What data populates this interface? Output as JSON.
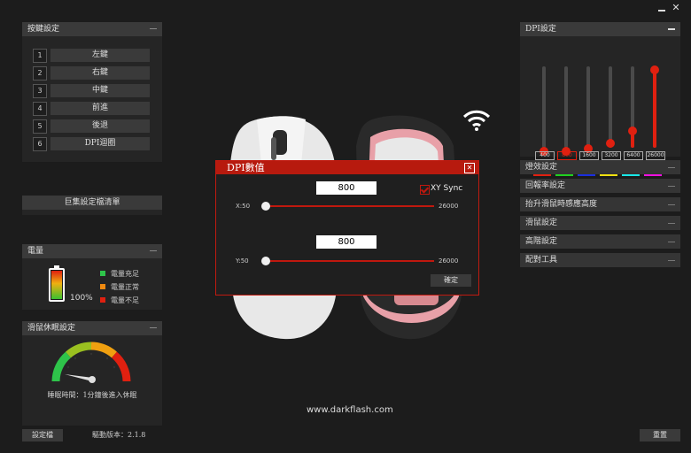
{
  "window": {
    "minimize_glyph": "—",
    "close_glyph": "✕"
  },
  "buttons_panel": {
    "title": "按鍵設定",
    "items": [
      {
        "num": "1",
        "label": "左鍵"
      },
      {
        "num": "2",
        "label": "右鍵"
      },
      {
        "num": "3",
        "label": "中鍵"
      },
      {
        "num": "4",
        "label": "前進"
      },
      {
        "num": "5",
        "label": "後退"
      },
      {
        "num": "6",
        "label": "DPI迴圈"
      }
    ]
  },
  "macro_list_label": "巨集設定檔清單",
  "battery": {
    "title": "電量",
    "percent_text": "100%",
    "level": 1.0,
    "legend": [
      {
        "label": "電量充足",
        "color": "#2ec44a"
      },
      {
        "label": "電量正常",
        "color": "#f08a10"
      },
      {
        "label": "電量不足",
        "color": "#e02010"
      }
    ]
  },
  "sleep": {
    "title": "滑鼠休眠設定",
    "text": "睡眠時間：1分鐘後進入休眠"
  },
  "footer": {
    "profile_button": "設定檔",
    "driver_version": "驅動版本：2.1.8",
    "reset_button": "重置",
    "website": "www.darkflash.com"
  },
  "dpi_panel": {
    "title": "DPI設定",
    "levels": [
      {
        "value": "400",
        "fill": 0.0,
        "color": "#e02010",
        "selected": false
      },
      {
        "value": "800",
        "fill": 0.0,
        "color": "#20d020",
        "selected": true
      },
      {
        "value": "1600",
        "fill": 0.03,
        "color": "#1a2ee0",
        "selected": false
      },
      {
        "value": "3200",
        "fill": 0.1,
        "color": "#f0e010",
        "selected": false
      },
      {
        "value": "6400",
        "fill": 0.25,
        "color": "#18e8e8",
        "selected": false
      },
      {
        "value": "26000",
        "fill": 1.0,
        "color": "#f010e0",
        "selected": false
      }
    ]
  },
  "right_menu": [
    "燈效設定",
    "回報率設定",
    "抬升滑鼠時感應高度",
    "滑鼠設定",
    "高階設定",
    "配對工具"
  ],
  "dpi_dialog": {
    "title": "DPI數值",
    "close_glyph": "✕",
    "x_value": "800",
    "y_value": "800",
    "xy_sync_label": "XY Sync",
    "xy_sync_checked": true,
    "x_min_label": "X:50",
    "x_max_label": "26000",
    "y_min_label": "Y:50",
    "y_max_label": "26000",
    "confirm_button": "確定"
  }
}
